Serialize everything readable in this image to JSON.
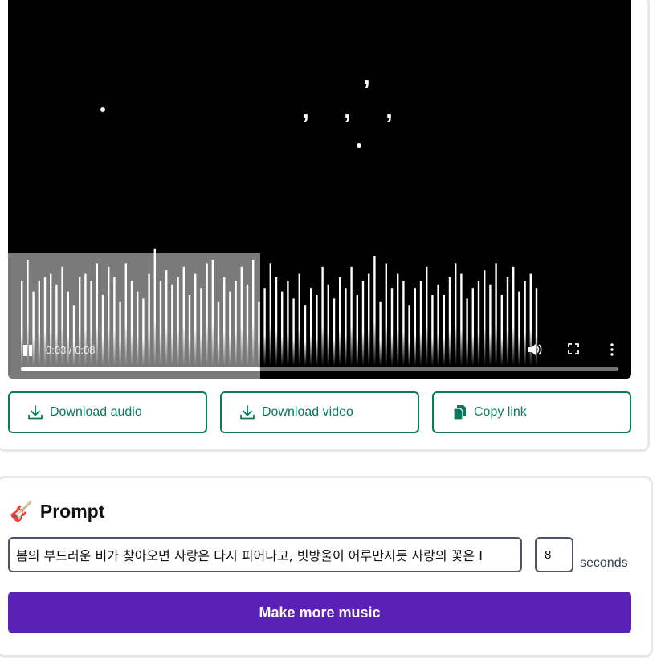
{
  "player": {
    "time_display": "0:03 / 0:08",
    "progress_fraction": 0.4,
    "buffered_fraction": 0.4
  },
  "actions": {
    "download_audio": "Download audio",
    "download_video": "Download video",
    "copy_link": "Copy link"
  },
  "prompt": {
    "emoji": "🎸",
    "title": "Prompt",
    "text": "봄의 부드러운 비가 찾아오면 사랑은 다시 피어나고, 빗방울이 어루만지듯 사랑의 꽃은 I",
    "duration_value": "8",
    "duration_unit": "seconds",
    "submit_label": "Make more music"
  },
  "colors": {
    "accent_green": "#0b7a5c",
    "submit_purple": "#5b21b6",
    "video_bg": "#000000"
  }
}
